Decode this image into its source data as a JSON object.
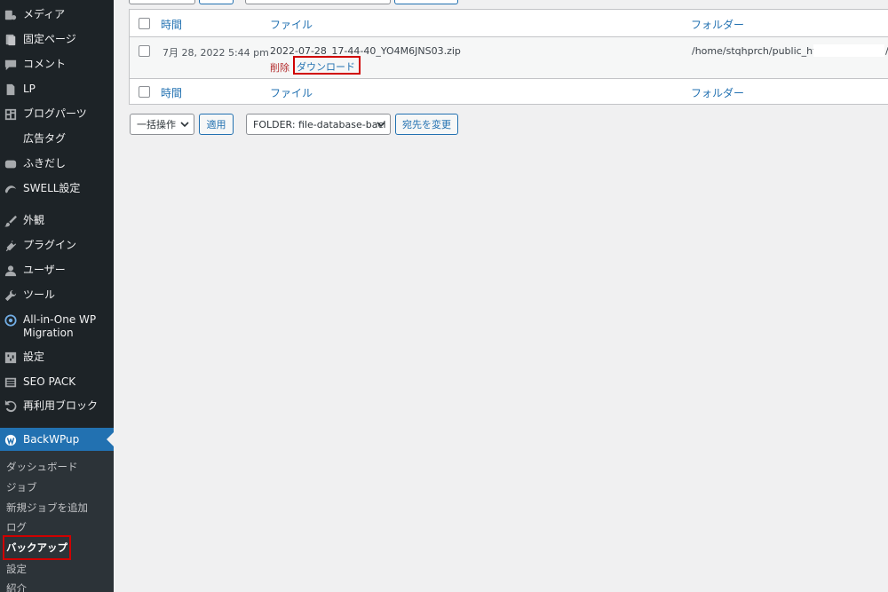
{
  "sidebar": {
    "items": [
      {
        "icon": "media-icon",
        "label": "メディア"
      },
      {
        "icon": "page-icon",
        "label": "固定ページ"
      },
      {
        "icon": "comment-icon",
        "label": "コメント"
      },
      {
        "icon": "document-icon",
        "label": "LP"
      },
      {
        "icon": "layout-icon",
        "label": "ブログパーツ"
      },
      {
        "icon": "",
        "label": "広告タグ"
      },
      {
        "icon": "speech-bubble-icon",
        "label": "ふきだし"
      },
      {
        "icon": "swell-icon",
        "label": "SWELL設定"
      },
      {
        "icon": "brush-icon",
        "label": "外観"
      },
      {
        "icon": "plugin-icon",
        "label": "プラグイン"
      },
      {
        "icon": "user-icon",
        "label": "ユーザー"
      },
      {
        "icon": "wrench-icon",
        "label": "ツール"
      },
      {
        "icon": "migration-icon",
        "label": "All-in-One WP Migration"
      },
      {
        "icon": "settings-icon",
        "label": "設定"
      },
      {
        "icon": "seo-pack-icon",
        "label": "SEO PACK"
      },
      {
        "icon": "reuse-icon",
        "label": "再利用ブロック"
      }
    ],
    "active": {
      "icon": "backwpup-icon",
      "label": "BackWPup"
    },
    "submenu": [
      {
        "label": "ダッシュボード"
      },
      {
        "label": "ジョブ"
      },
      {
        "label": "新規ジョブを追加"
      },
      {
        "label": "ログ"
      },
      {
        "label": "バックアップ",
        "current": true
      },
      {
        "label": "設定"
      },
      {
        "label": "紹介"
      }
    ]
  },
  "table": {
    "columns": {
      "time": "時間",
      "file": "ファイル",
      "folder": "フォルダー"
    },
    "rows": [
      {
        "time": "7月 28, 2022 5:44 pm",
        "file": "2022-07-28_17-44-40_YO4M6JNS03.zip",
        "folder": "/home/stqhprch/public_html",
        "folder_suffix": "/",
        "actions": {
          "delete": "削除",
          "download": "ダウンロード"
        }
      }
    ]
  },
  "bottom_controls": {
    "bulk_action": "一括操作",
    "apply": "適用",
    "folder_select": "FOLDER: file-database-bacl",
    "change_destination": "宛先を変更"
  },
  "colors": {
    "sidebar_bg": "#1d2327",
    "accent": "#2271b1",
    "highlight": "#d00000",
    "delete": "#b32d2e"
  }
}
